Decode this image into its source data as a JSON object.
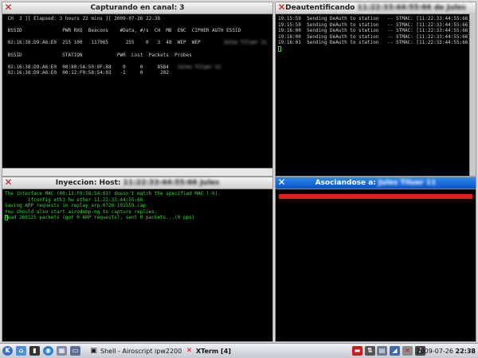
{
  "windows": {
    "capture": {
      "title": "Capturando en canal:  3",
      "lines": [
        " CH  3 ][ Elapsed: 3 hours 22 mins ][ 2009-07-26 22:38",
        "",
        " BSSID              PWR RXQ  Beacons    #Data, #/s  CH  MB  ENC  CIPHER AUTH ESSID",
        "",
        " 02:16:38:D9:A6:E0  255 100   117065      255    0   3  48  WEP  WEP",
        "",
        " BSSID              STATION            PWR  Lost  Packets  Probes",
        "",
        " 02:16:38:D9:A6:E0  00:80:5A:50:9F:88    0     0     8584",
        " 02:16:38:D9:A6:E0  00:12:F0:58:54:03   -1     0      202"
      ]
    },
    "deauth": {
      "title": "Deautentificando",
      "lines": [
        "19:15:59  Sending DeAuth to station   -- STMAC: [11:22:33:44:55:66]",
        "19:15:59  Sending DeAuth to station   -- STMAC: [11:22:33:44:55:66]",
        "19:16:00  Sending DeAuth to station   -- STMAC: [11:22:33:44:55:66]",
        "19:16:00  Sending DeAuth to station   -- STMAC: [11:22:33:44:55:66]",
        "19:16:01  Sending DeAuth to station   -- STMAC: [11:22:33:44:55:66]"
      ]
    },
    "injection": {
      "title": "Inyeccion: Host:",
      "lines": [
        "The interface MAC (00:12:F0:58:54:03) doesn't match the specified MAC (-h).",
        "        ifconfig eth1 hw ether 11:22:33:44:55:66",
        "Saving ARP requests in replay_arp-0726-191559.cap",
        "You should also start airodump-ng to capture replies.",
        "Read 260125 packets (got 0 ARP requests), sent 0 packets...(0 pps)"
      ]
    },
    "assoc": {
      "title": "Asociandose a:"
    }
  },
  "taskbar": {
    "tasks": [
      {
        "label": "Shell - Airoscript ipw2200",
        "icon": "shell-icon"
      },
      {
        "label": "XTerm [4]",
        "icon": "xterm-icon"
      }
    ],
    "date": "2009-07-26",
    "time": "22:38"
  },
  "colors": {
    "active_title": "#0a55c8",
    "terminal_bg": "#000000",
    "green_text": "#3fd03f",
    "red_bar": "#e02020"
  }
}
